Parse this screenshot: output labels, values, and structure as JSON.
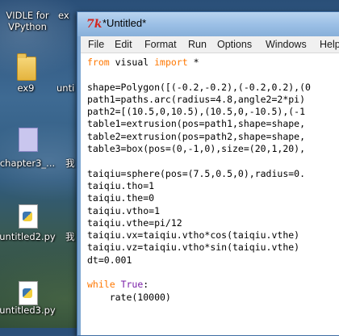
{
  "desktop": {
    "icons": [
      {
        "label": "VIDLE for\nVPython",
        "kind": "partial"
      },
      {
        "label": "ex9",
        "kind": "folder"
      },
      {
        "label": "unti",
        "kind": "partial"
      },
      {
        "label": "chapter3_...",
        "kind": "doc"
      },
      {
        "label": "我",
        "kind": "partial"
      },
      {
        "label": "untitled2.py",
        "kind": "py"
      },
      {
        "label": "我",
        "kind": "partial"
      },
      {
        "label": "untitled3.py",
        "kind": "py"
      },
      {
        "label": "ex",
        "kind": "partial"
      }
    ]
  },
  "window": {
    "title": "*Untitled*",
    "menu": [
      "File",
      "Edit",
      "Format",
      "Run",
      "Options",
      "Windows",
      "Help"
    ]
  },
  "code_lines": [
    [
      {
        "t": "from",
        "c": "kw"
      },
      {
        "t": " visual ",
        "c": ""
      },
      {
        "t": "import",
        "c": "kw"
      },
      {
        "t": " *",
        "c": ""
      }
    ],
    [],
    [
      {
        "t": "shape=Polygon([(-0.2,-0.2),(-0.2,0.2),(0",
        "c": ""
      }
    ],
    [
      {
        "t": "path1=paths.arc(radius=4.8,angle2=2*pi)",
        "c": ""
      }
    ],
    [
      {
        "t": "path2=[(10.5,0,10.5),(10.5,0,-10.5),(-1",
        "c": ""
      }
    ],
    [
      {
        "t": "table1=extrusion(pos=path1,shape=shape,",
        "c": ""
      }
    ],
    [
      {
        "t": "table2=extrusion(pos=path2,shape=shape,",
        "c": ""
      }
    ],
    [
      {
        "t": "table3=box(pos=(0,-1,0),size=(20,1,20),",
        "c": ""
      }
    ],
    [],
    [
      {
        "t": "taiqiu=sphere(pos=(7.5,0.5,0),radius=0.",
        "c": ""
      }
    ],
    [
      {
        "t": "taiqiu.tho=1",
        "c": ""
      }
    ],
    [
      {
        "t": "taiqiu.the=0",
        "c": ""
      }
    ],
    [
      {
        "t": "taiqiu.vtho=1",
        "c": ""
      }
    ],
    [
      {
        "t": "taiqiu.vthe=pi/12",
        "c": ""
      }
    ],
    [
      {
        "t": "taiqiu.vx=taiqiu.vtho*cos(taiqiu.vthe)",
        "c": ""
      }
    ],
    [
      {
        "t": "taiqiu.vz=taiqiu.vtho*sin(taiqiu.vthe)",
        "c": ""
      }
    ],
    [
      {
        "t": "dt=0.001",
        "c": ""
      }
    ],
    [],
    [
      {
        "t": "while",
        "c": "kw"
      },
      {
        "t": " ",
        "c": ""
      },
      {
        "t": "True",
        "c": "kw2"
      },
      {
        "t": ":",
        "c": ""
      }
    ],
    [
      {
        "t": "    rate(10000)",
        "c": ""
      }
    ]
  ]
}
